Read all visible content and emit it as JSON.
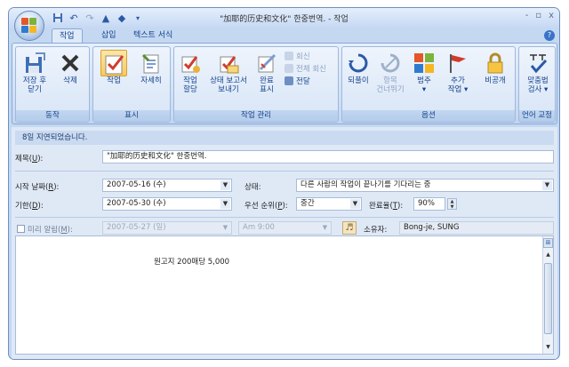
{
  "window": {
    "title": "\"加耶的历史和文化\" 한중번역. - 작업",
    "controls": [
      "-",
      "▫",
      "x"
    ]
  },
  "quick_access": [
    "save-icon",
    "undo-icon",
    "redo-icon",
    "up-arrow-icon",
    "down-arrow-icon",
    "customize-icon"
  ],
  "tabs": [
    {
      "label": "작업",
      "active": true
    },
    {
      "label": "삽입",
      "active": false
    },
    {
      "label": "텍스트 서식",
      "active": false
    }
  ],
  "ribbon": {
    "groups": {
      "actions": "동작",
      "show": "표시",
      "manage_task": "작업 관리",
      "options": "옵션",
      "proofing": "언어 교정"
    },
    "buttons": {
      "save_close": "저장 후\n닫기",
      "delete": "삭제",
      "task": "작업",
      "details": "자세히",
      "assign_task": "작업\n할당",
      "send_status": "상태 보고서\n보내기",
      "mark_complete": "완료\n표시",
      "reply": "회신",
      "reply_all": "전체 회신",
      "forward": "전달",
      "recurrence": "되풀이",
      "skip": "항목\n건너뛰기",
      "categorize": "범주\n▾",
      "follow_up": "추가\n작업 ▾",
      "private": "비공개",
      "spelling": "맞춤법\n검사 ▾"
    }
  },
  "form": {
    "info_bar": "8일 지연되었습니다.",
    "subject_label": "제목",
    "subject_key": "U",
    "subject_value": "\"加耶的历史和文化\" 한중번역.",
    "start_label": "시작 날짜",
    "start_key": "R",
    "start_value": "2007-05-16 (수)",
    "status_label": "상태:",
    "status_value": "다른 사람의 작업이 끝나기를 기다리는 중",
    "due_label": "기한",
    "due_key": "D",
    "due_value": "2007-05-30 (수)",
    "priority_label": "우선 순위",
    "priority_key": "P",
    "priority_value": "중간",
    "complete_label": "완료율",
    "complete_key": "T",
    "complete_value": "90%",
    "reminder_label": "미리 알림",
    "reminder_key": "M",
    "reminder_date": "2007-05-27 (일)",
    "reminder_time": "Am 9:00",
    "owner_label": "소유자:",
    "owner_value": "Bong-je, SUNG",
    "body_text": "원고지 200매당 5,000"
  },
  "colors": {
    "accent": "#15428b",
    "ribbon_bg": "#d7e5f7",
    "frame": "#c4d8f2",
    "info_bar": "#c9daf1"
  }
}
